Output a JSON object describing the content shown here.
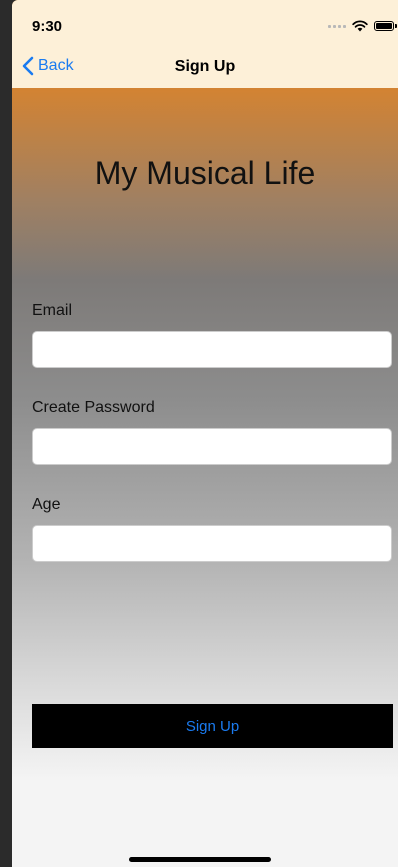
{
  "status_bar": {
    "time": "9:30"
  },
  "nav": {
    "back_label": "Back",
    "title": "Sign Up"
  },
  "app": {
    "title": "My Musical Life"
  },
  "form": {
    "fields": [
      {
        "label": "Email",
        "value": "",
        "placeholder": ""
      },
      {
        "label": "Create Password",
        "value": "",
        "placeholder": ""
      },
      {
        "label": "Age",
        "value": "",
        "placeholder": ""
      }
    ],
    "submit_label": "Sign Up"
  },
  "colors": {
    "accent": "#1a7bf0",
    "nav_background": "#fdf0d8",
    "gradient_top": "#e8841e",
    "gradient_bottom": "#f4f4f4",
    "button_background": "#000000"
  }
}
